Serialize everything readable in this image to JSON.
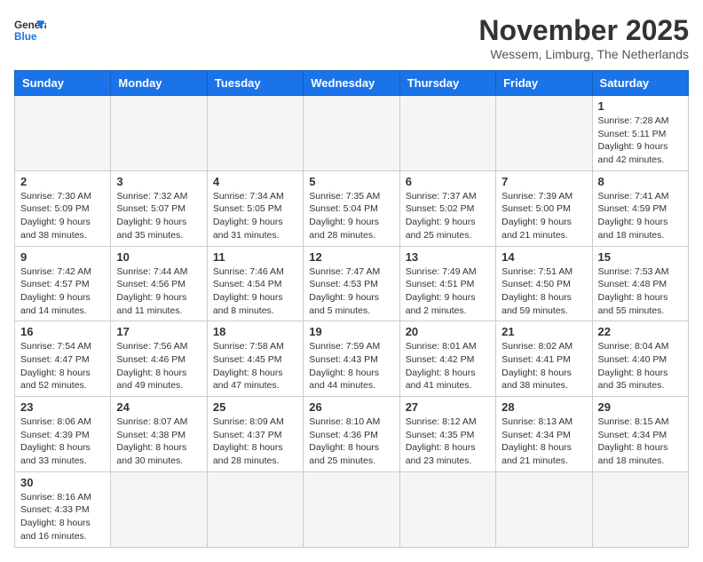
{
  "header": {
    "logo_general": "General",
    "logo_blue": "Blue",
    "title": "November 2025",
    "subtitle": "Wessem, Limburg, The Netherlands"
  },
  "weekdays": [
    "Sunday",
    "Monday",
    "Tuesday",
    "Wednesday",
    "Thursday",
    "Friday",
    "Saturday"
  ],
  "weeks": [
    [
      {
        "day": "",
        "empty": true
      },
      {
        "day": "",
        "empty": true
      },
      {
        "day": "",
        "empty": true
      },
      {
        "day": "",
        "empty": true
      },
      {
        "day": "",
        "empty": true
      },
      {
        "day": "",
        "empty": true
      },
      {
        "day": "1",
        "info": "Sunrise: 7:28 AM\nSunset: 5:11 PM\nDaylight: 9 hours and 42 minutes."
      }
    ],
    [
      {
        "day": "2",
        "info": "Sunrise: 7:30 AM\nSunset: 5:09 PM\nDaylight: 9 hours and 38 minutes."
      },
      {
        "day": "3",
        "info": "Sunrise: 7:32 AM\nSunset: 5:07 PM\nDaylight: 9 hours and 35 minutes."
      },
      {
        "day": "4",
        "info": "Sunrise: 7:34 AM\nSunset: 5:05 PM\nDaylight: 9 hours and 31 minutes."
      },
      {
        "day": "5",
        "info": "Sunrise: 7:35 AM\nSunset: 5:04 PM\nDaylight: 9 hours and 28 minutes."
      },
      {
        "day": "6",
        "info": "Sunrise: 7:37 AM\nSunset: 5:02 PM\nDaylight: 9 hours and 25 minutes."
      },
      {
        "day": "7",
        "info": "Sunrise: 7:39 AM\nSunset: 5:00 PM\nDaylight: 9 hours and 21 minutes."
      },
      {
        "day": "8",
        "info": "Sunrise: 7:41 AM\nSunset: 4:59 PM\nDaylight: 9 hours and 18 minutes."
      }
    ],
    [
      {
        "day": "9",
        "info": "Sunrise: 7:42 AM\nSunset: 4:57 PM\nDaylight: 9 hours and 14 minutes."
      },
      {
        "day": "10",
        "info": "Sunrise: 7:44 AM\nSunset: 4:56 PM\nDaylight: 9 hours and 11 minutes."
      },
      {
        "day": "11",
        "info": "Sunrise: 7:46 AM\nSunset: 4:54 PM\nDaylight: 9 hours and 8 minutes."
      },
      {
        "day": "12",
        "info": "Sunrise: 7:47 AM\nSunset: 4:53 PM\nDaylight: 9 hours and 5 minutes."
      },
      {
        "day": "13",
        "info": "Sunrise: 7:49 AM\nSunset: 4:51 PM\nDaylight: 9 hours and 2 minutes."
      },
      {
        "day": "14",
        "info": "Sunrise: 7:51 AM\nSunset: 4:50 PM\nDaylight: 8 hours and 59 minutes."
      },
      {
        "day": "15",
        "info": "Sunrise: 7:53 AM\nSunset: 4:48 PM\nDaylight: 8 hours and 55 minutes."
      }
    ],
    [
      {
        "day": "16",
        "info": "Sunrise: 7:54 AM\nSunset: 4:47 PM\nDaylight: 8 hours and 52 minutes."
      },
      {
        "day": "17",
        "info": "Sunrise: 7:56 AM\nSunset: 4:46 PM\nDaylight: 8 hours and 49 minutes."
      },
      {
        "day": "18",
        "info": "Sunrise: 7:58 AM\nSunset: 4:45 PM\nDaylight: 8 hours and 47 minutes."
      },
      {
        "day": "19",
        "info": "Sunrise: 7:59 AM\nSunset: 4:43 PM\nDaylight: 8 hours and 44 minutes."
      },
      {
        "day": "20",
        "info": "Sunrise: 8:01 AM\nSunset: 4:42 PM\nDaylight: 8 hours and 41 minutes."
      },
      {
        "day": "21",
        "info": "Sunrise: 8:02 AM\nSunset: 4:41 PM\nDaylight: 8 hours and 38 minutes."
      },
      {
        "day": "22",
        "info": "Sunrise: 8:04 AM\nSunset: 4:40 PM\nDaylight: 8 hours and 35 minutes."
      }
    ],
    [
      {
        "day": "23",
        "info": "Sunrise: 8:06 AM\nSunset: 4:39 PM\nDaylight: 8 hours and 33 minutes."
      },
      {
        "day": "24",
        "info": "Sunrise: 8:07 AM\nSunset: 4:38 PM\nDaylight: 8 hours and 30 minutes."
      },
      {
        "day": "25",
        "info": "Sunrise: 8:09 AM\nSunset: 4:37 PM\nDaylight: 8 hours and 28 minutes."
      },
      {
        "day": "26",
        "info": "Sunrise: 8:10 AM\nSunset: 4:36 PM\nDaylight: 8 hours and 25 minutes."
      },
      {
        "day": "27",
        "info": "Sunrise: 8:12 AM\nSunset: 4:35 PM\nDaylight: 8 hours and 23 minutes."
      },
      {
        "day": "28",
        "info": "Sunrise: 8:13 AM\nSunset: 4:34 PM\nDaylight: 8 hours and 21 minutes."
      },
      {
        "day": "29",
        "info": "Sunrise: 8:15 AM\nSunset: 4:34 PM\nDaylight: 8 hours and 18 minutes."
      }
    ],
    [
      {
        "day": "30",
        "info": "Sunrise: 8:16 AM\nSunset: 4:33 PM\nDaylight: 8 hours and 16 minutes."
      },
      {
        "day": "",
        "empty": true
      },
      {
        "day": "",
        "empty": true
      },
      {
        "day": "",
        "empty": true
      },
      {
        "day": "",
        "empty": true
      },
      {
        "day": "",
        "empty": true
      },
      {
        "day": "",
        "empty": true
      }
    ]
  ]
}
